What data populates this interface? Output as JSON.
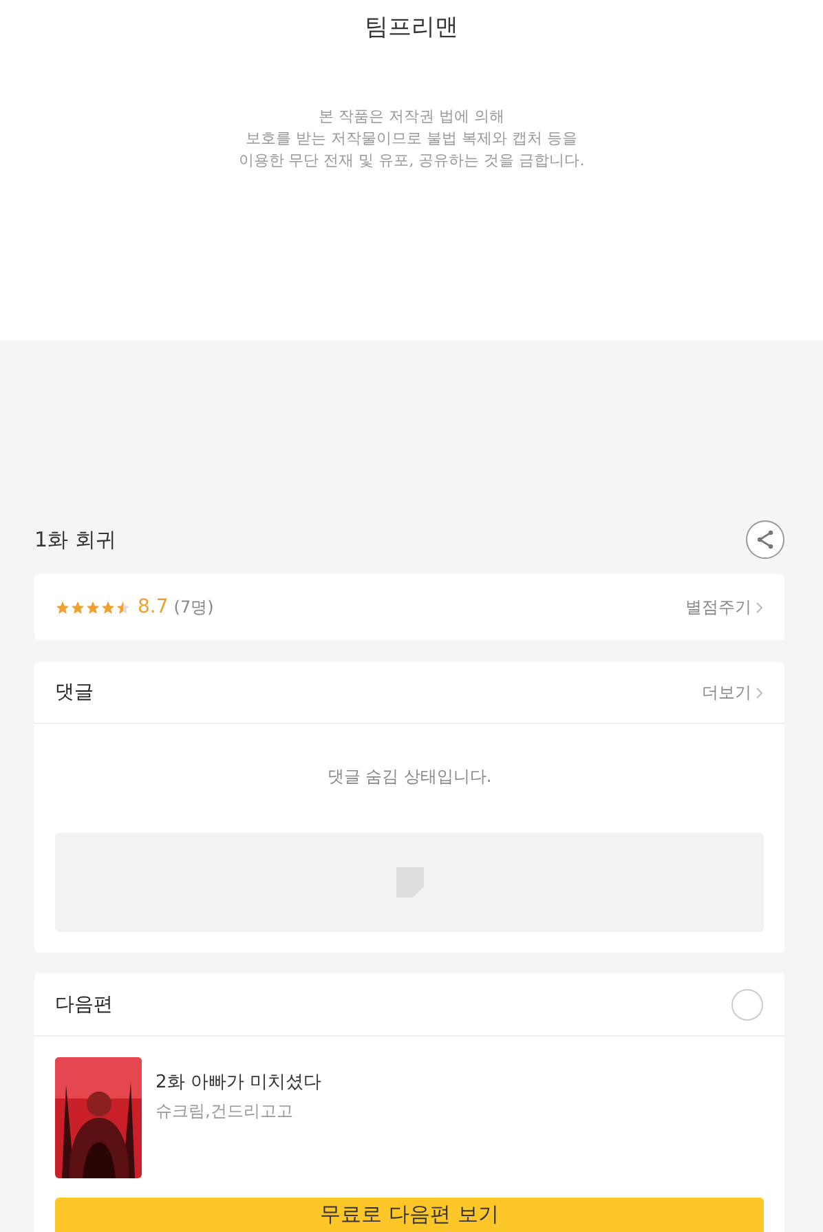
{
  "credits": {
    "line": "팀프리맨"
  },
  "notice": "본 작품은 저작권 법에 의해\n보호를 받는 저작물이므로 불법 복제와 캡처 등을\n이용한 무단 전재 및 유포, 공유하는 것을 금합니다.",
  "episode": {
    "title": "1화 회귀"
  },
  "rating": {
    "stars": 4.5,
    "score": "8.7",
    "count": "(7명)",
    "action": "별점주기"
  },
  "comments": {
    "title": "댓글",
    "more": "더보기",
    "message": "댓글 숨김 상태입니다."
  },
  "next": {
    "title": "다음편",
    "episode_title": "2화 아빠가 미치셨다",
    "authors": "슈크림,건드리고고",
    "button": "무료로 다음편 보기"
  }
}
